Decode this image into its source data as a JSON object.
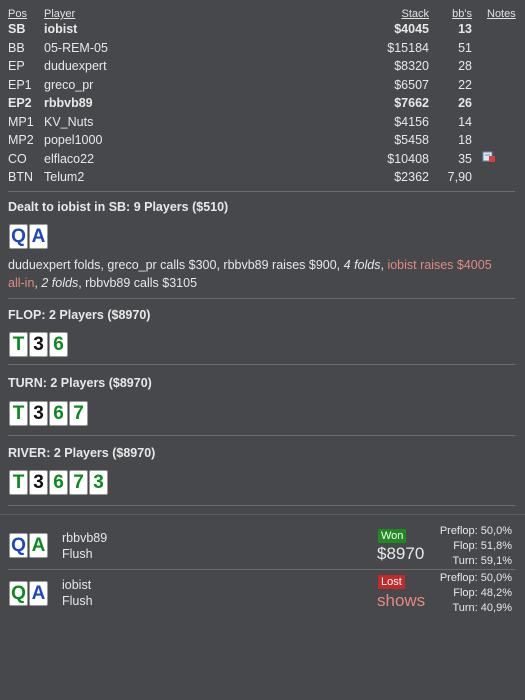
{
  "table": {
    "headers": {
      "pos": "Pos",
      "player": "Player",
      "stack": "Stack",
      "bbs": "bb's",
      "notes": "Notes"
    },
    "rows": [
      {
        "pos": "SB",
        "name": "iobist",
        "stack": "$4045",
        "bb": "13",
        "bold": true
      },
      {
        "pos": "BB",
        "name": "05-REM-05",
        "stack": "$15184",
        "bb": "51",
        "bold": false
      },
      {
        "pos": "EP",
        "name": "duduexpert",
        "stack": "$8320",
        "bb": "28",
        "bold": false
      },
      {
        "pos": "EP1",
        "name": "greco_pr",
        "stack": "$6507",
        "bb": "22",
        "bold": false
      },
      {
        "pos": "EP2",
        "name": "rbbvb89",
        "stack": "$7662",
        "bb": "26",
        "bold": true
      },
      {
        "pos": "MP1",
        "name": "KV_Nuts",
        "stack": "$4156",
        "bb": "14",
        "bold": false
      },
      {
        "pos": "MP2",
        "name": "popel1000",
        "stack": "$5458",
        "bb": "18",
        "bold": false
      },
      {
        "pos": "CO",
        "name": "elflaco22",
        "stack": "$10408",
        "bb": "35",
        "bold": false,
        "note": "note-icon"
      },
      {
        "pos": "BTN",
        "name": "Telum2",
        "stack": "$2362",
        "bb": "7,90",
        "bold": false
      }
    ]
  },
  "preflop": {
    "title": "Dealt to iobist in SB: 9 Players ($510)",
    "cards": [
      {
        "r": "Q",
        "s": "d"
      },
      {
        "r": "A",
        "s": "d"
      }
    ],
    "action": {
      "p1": "duduexpert folds, greco_pr calls $300, rbbvb89 raises $900, ",
      "p2": "4 folds",
      "p3": ", ",
      "p4": "iobist raises $4005 all-in",
      "p5": ", ",
      "p6": "2 folds",
      "p7": ", rbbvb89 calls $3105"
    }
  },
  "flop": {
    "title": "FLOP: 2 Players ($8970)",
    "cards": [
      {
        "r": "T",
        "s": "h"
      },
      {
        "r": "3",
        "s": "s"
      },
      {
        "r": "6",
        "s": "h"
      }
    ]
  },
  "turn": {
    "title": "TURN: 2 Players ($8970)",
    "cards": [
      {
        "r": "T",
        "s": "h"
      },
      {
        "r": "3",
        "s": "s"
      },
      {
        "r": "6",
        "s": "h"
      },
      {
        "r": "7",
        "s": "h"
      }
    ]
  },
  "river": {
    "title": "RIVER: 2 Players ($8970)",
    "cards": [
      {
        "r": "T",
        "s": "h"
      },
      {
        "r": "3",
        "s": "s"
      },
      {
        "r": "6",
        "s": "h"
      },
      {
        "r": "7",
        "s": "h"
      },
      {
        "r": "3",
        "s": "h"
      }
    ]
  },
  "results": [
    {
      "cards": [
        {
          "r": "Q",
          "s": "d"
        },
        {
          "r": "A",
          "s": "h"
        }
      ],
      "name": "rbbvb89",
      "hand": "Flush",
      "badge": "Won",
      "amount": "$8970",
      "equity": [
        {
          "label": "Preflop:",
          "val": "50,0%"
        },
        {
          "label": "Flop:",
          "val": "51,8%"
        },
        {
          "label": "Turn:",
          "val": "59,1%"
        }
      ]
    },
    {
      "cards": [
        {
          "r": "Q",
          "s": "h"
        },
        {
          "r": "A",
          "s": "d"
        }
      ],
      "name": "iobist",
      "hand": "Flush",
      "badge": "Lost",
      "amount": "shows",
      "equity": [
        {
          "label": "Preflop:",
          "val": "50,0%"
        },
        {
          "label": "Flop:",
          "val": "48,2%"
        },
        {
          "label": "Turn:",
          "val": "40,9%"
        }
      ]
    }
  ],
  "colors": {
    "background": "#46484c",
    "won": "#1f8b1f",
    "lost": "#c22a2a",
    "raise_text": "#e28a80",
    "hearts": "#0b8a1f",
    "diamonds": "#1b47c4"
  }
}
